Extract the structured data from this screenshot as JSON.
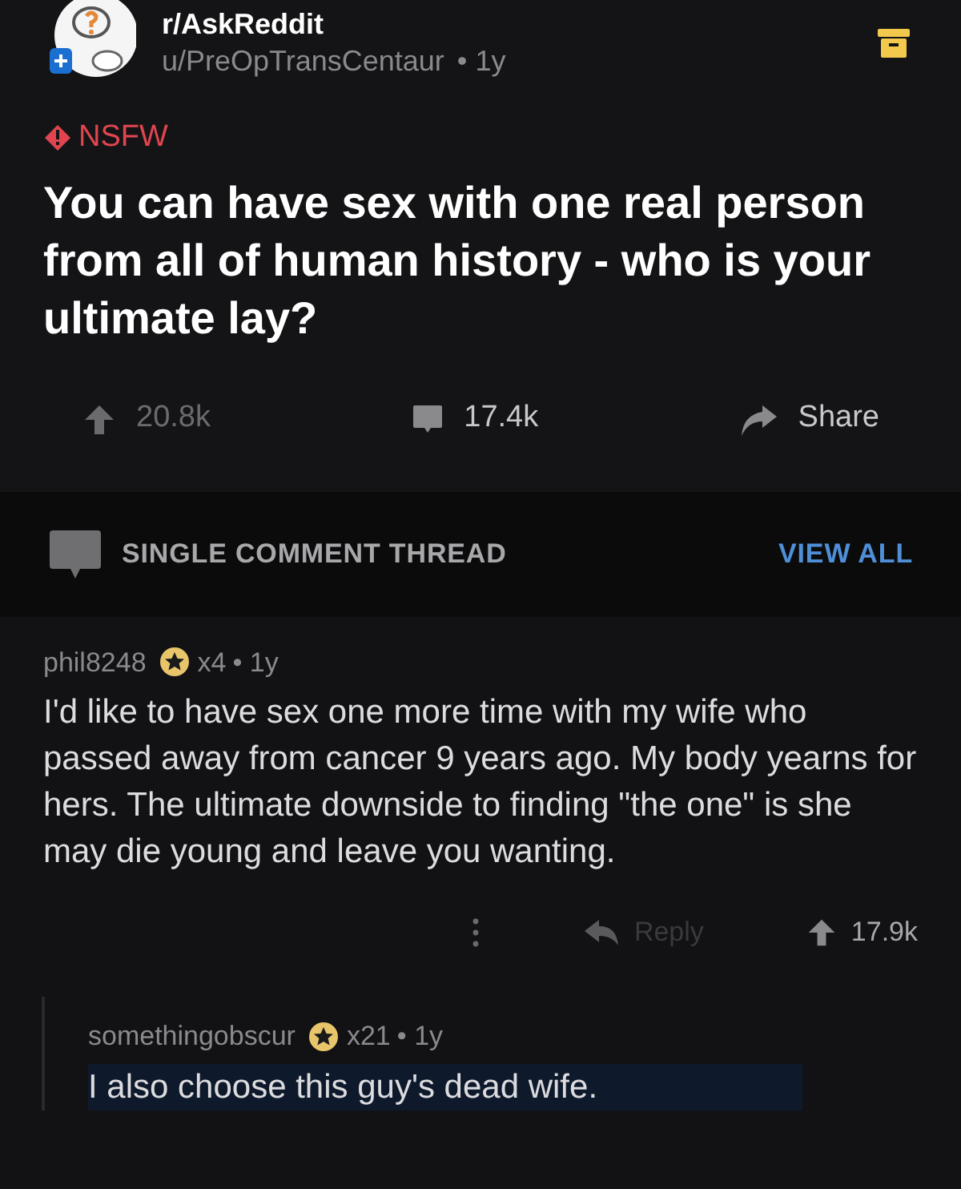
{
  "post": {
    "subreddit": "r/AskReddit",
    "author": "u/PreOpTransCentaur",
    "age": "• 1y",
    "nsfw_label": "NSFW",
    "title": "You can have sex with one real person from all of human history - who is your ultimate lay?",
    "actions": [
      {
        "kind": "upvote",
        "label": "20.8k"
      },
      {
        "kind": "comments",
        "label": "17.4k"
      },
      {
        "kind": "share",
        "label": "Share"
      }
    ]
  },
  "thread_bar": {
    "label": "SINGLE COMMENT THREAD",
    "link": "VIEW ALL"
  },
  "comments": [
    {
      "author": "phil8248",
      "awards": "x4",
      "age": "• 1y",
      "body": "I'd like to have sex one more time with my wife who passed away from cancer 9 years ago. My body yearns for hers. The ultimate downside to finding \"the one\" is she may die young and leave you wanting.",
      "highlighted": false,
      "reply": "Reply",
      "score": "17.9k"
    },
    {
      "author": "somethingobscur",
      "awards": "x21",
      "age": "• 1y",
      "body": "I also choose this guy's dead wife.",
      "highlighted": true
    }
  ]
}
